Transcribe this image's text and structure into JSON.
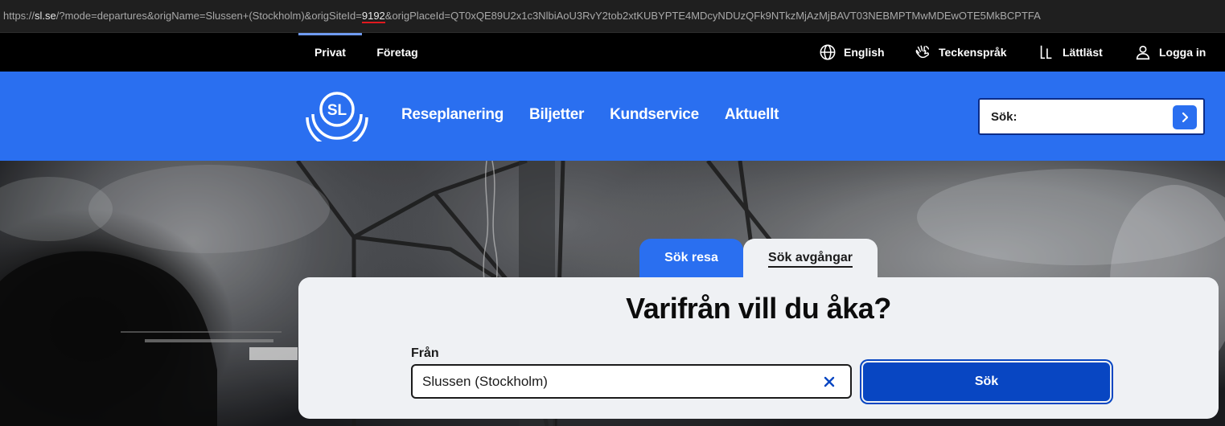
{
  "browser": {
    "url_prefix": "https://",
    "url_host": "sl.se",
    "url_before_mark": "/?mode=departures&origName=Slussen+(Stockholm)&origSiteId=",
    "url_mark": "9192",
    "url_after_mark": "&origPlaceId=QT0xQE89U2x1c3NlbiAoU3RvY2tob2xtKUBYPTE4MDcyNDUzQFk9NTkzMjAzMjBAVT03NEBMPTMwMDEwOTE5MkBCPTFA"
  },
  "topbar": {
    "segments": [
      {
        "label": "Privat",
        "active": true
      },
      {
        "label": "Företag",
        "active": false
      }
    ],
    "utilities": [
      {
        "label": "English",
        "icon": "globe-icon"
      },
      {
        "label": "Teckenspråk",
        "icon": "sign-language-hand-icon"
      },
      {
        "label": "Lättläst",
        "icon": "easy-read-icon"
      },
      {
        "label": "Logga in",
        "icon": "user-icon"
      }
    ]
  },
  "header": {
    "logo_text": "SL",
    "nav": [
      "Reseplanering",
      "Biljetter",
      "Kundservice",
      "Aktuellt"
    ],
    "search_label": "Sök:",
    "search_value": "",
    "search_button_icon": "chevron-right-icon"
  },
  "tabs": [
    {
      "label": "Sök resa",
      "active": false
    },
    {
      "label": "Sök avgångar",
      "active": true
    }
  ],
  "search_card": {
    "title": "Varifrån vill du åka?",
    "from_label": "Från",
    "from_value": "Slussen (Stockholm)",
    "clear_icon": "close-icon",
    "submit_label": "Sök"
  },
  "colors": {
    "brand_blue": "#2a6ff0",
    "dark_blue": "#0846c2",
    "card_bg": "#eff1f4"
  }
}
